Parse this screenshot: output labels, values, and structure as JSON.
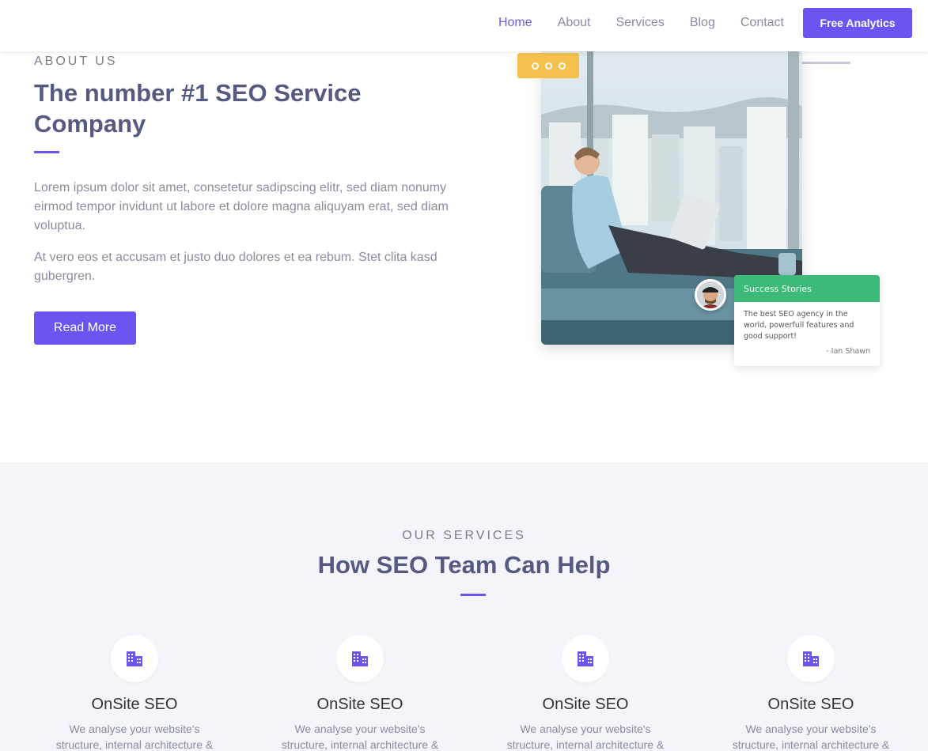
{
  "nav": {
    "items": [
      {
        "label": "Home",
        "active": true
      },
      {
        "label": "About"
      },
      {
        "label": "Services"
      },
      {
        "label": "Blog"
      },
      {
        "label": "Contact"
      }
    ],
    "cta_label": "Free Analytics"
  },
  "about": {
    "label": "ABOUT US",
    "title": "The number #1 SEO Service Company",
    "para1": "Lorem ipsum dolor sit amet, consetetur sadipscing elitr, sed diam nonumy eirmod tempor invidunt ut labore et dolore magna aliquyam erat, sed diam voluptua.",
    "para2": "At vero eos et accusam et justo duo dolores et ea rebum. Stet clita kasd gubergren.",
    "button_label": "Read More"
  },
  "story_card": {
    "title": "Success Stories",
    "text": "The best SEO agency in the world, powerfull features and good support!",
    "author": "- Ian Shawn"
  },
  "services": {
    "label": "OUR SERVICES",
    "title": "How SEO Team Can Help",
    "items": [
      {
        "title": "OnSite SEO",
        "desc": "We analyse your website's structure, internal architecture & other key",
        "icon": "building-icon"
      },
      {
        "title": "OnSite SEO",
        "desc": "We analyse your website's structure, internal architecture & other key",
        "icon": "building-icon"
      },
      {
        "title": "OnSite SEO",
        "desc": "We analyse your website's structure, internal architecture & other key",
        "icon": "building-icon"
      },
      {
        "title": "OnSite SEO",
        "desc": "We analyse your website's structure, internal architecture & other key",
        "icon": "building-icon"
      }
    ]
  },
  "colors": {
    "accent": "#6b55f2",
    "badge": "#f5c04d",
    "success": "#3cbb78",
    "services_bg": "#f4f4fb"
  }
}
